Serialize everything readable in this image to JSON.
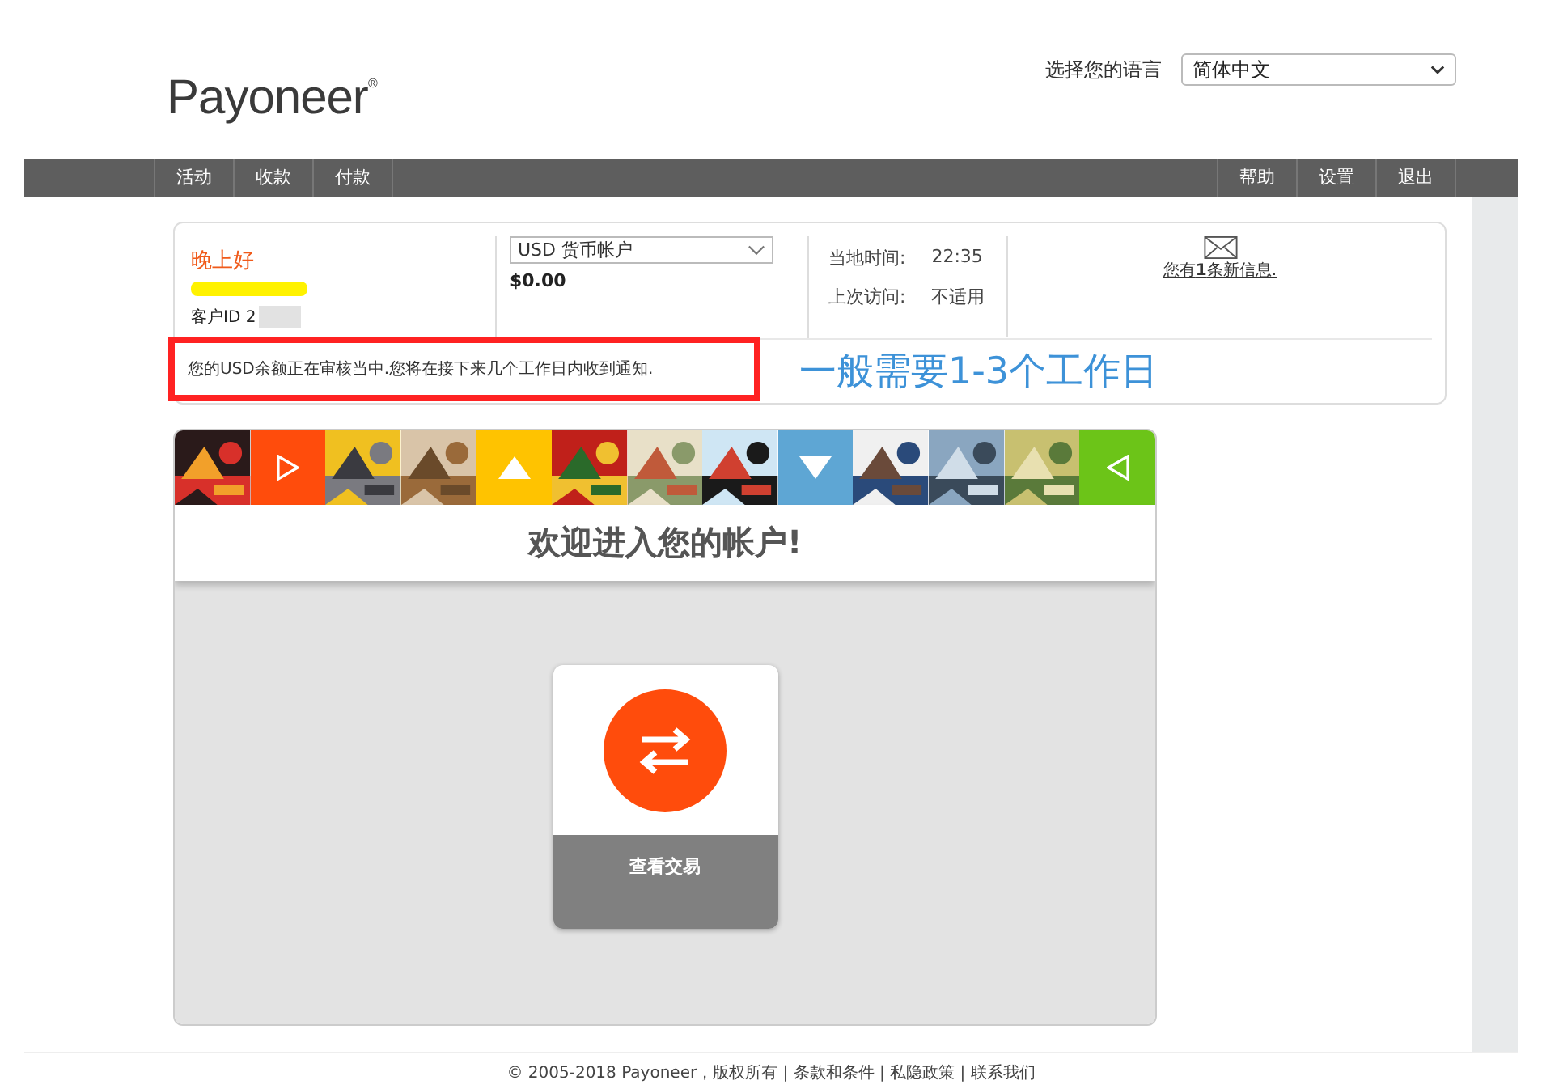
{
  "logo": {
    "text": "Payoneer",
    "mark": "®"
  },
  "language": {
    "label": "选择您的语言",
    "value": "简体中文"
  },
  "nav": {
    "left": [
      "活动",
      "收款",
      "付款"
    ],
    "right": [
      "帮助",
      "设置",
      "退出"
    ]
  },
  "account": {
    "greeting": "晚上好",
    "customer_id": "客户ID 2",
    "currency": "USD 货币帐户",
    "balance": "$0.00",
    "local_time_label": "当地时间:",
    "local_time": "22:35",
    "last_visit_label": "上次访问:",
    "last_visit": "不适用",
    "messages": "您有**1**条新信息.",
    "notice": "您的USD余额正在审核当中.您将在接下来几个工作日内收到通知."
  },
  "annotation": "一般需要1-3个工作日",
  "banner": {
    "tiles": [
      {
        "kind": "picture"
      },
      {
        "kind": "right",
        "color": "#ff4c0c"
      },
      {
        "kind": "picture"
      },
      {
        "kind": "picture"
      },
      {
        "kind": "up",
        "color": "#ffc300"
      },
      {
        "kind": "picture"
      },
      {
        "kind": "picture"
      },
      {
        "kind": "picture"
      },
      {
        "kind": "down",
        "color": "#5ea6d4"
      },
      {
        "kind": "picture"
      },
      {
        "kind": "picture"
      },
      {
        "kind": "picture"
      },
      {
        "kind": "left",
        "color": "#6cc418"
      }
    ],
    "title": "欢迎进入您的帐户!"
  },
  "action": {
    "label": "查看交易"
  },
  "footer": "© 2005-2018 Payoneer，版权所有 | 条款和条件 | 私隐政策 | 联系我们"
}
